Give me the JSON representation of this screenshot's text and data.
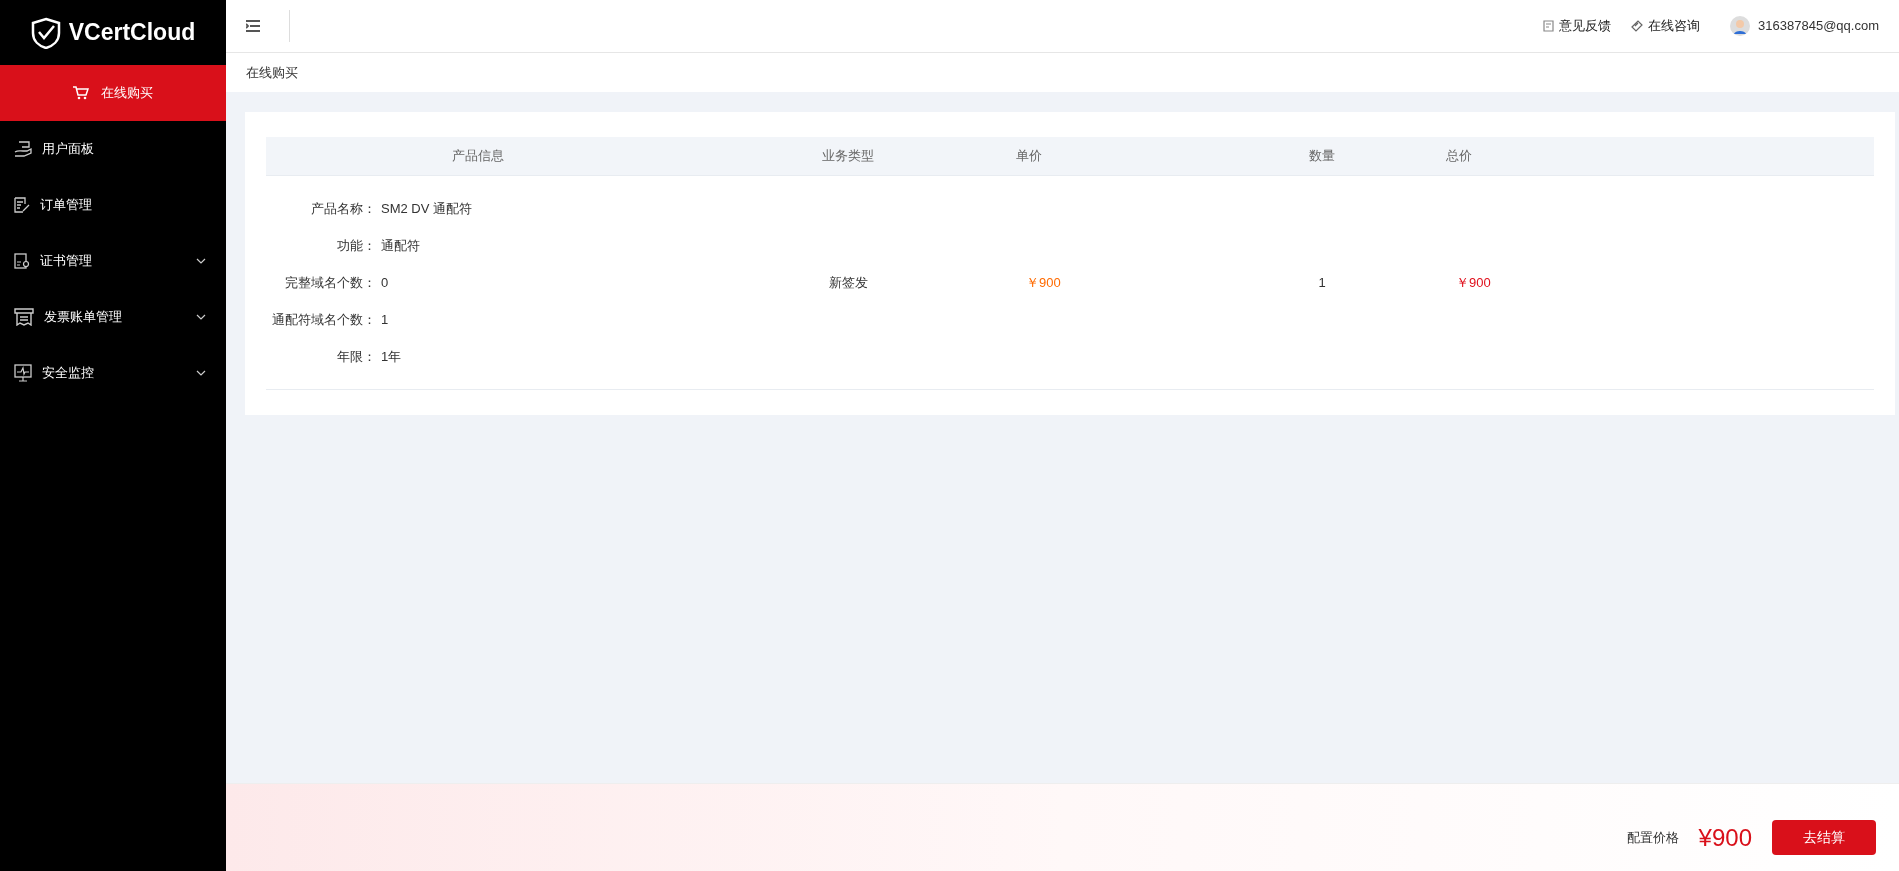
{
  "sidebar": {
    "logo": "VCertCloud",
    "items": [
      {
        "label": "在线购买",
        "selected": true,
        "has_submenu": false
      },
      {
        "label": "用户面板",
        "selected": false,
        "has_submenu": false
      },
      {
        "label": "订单管理",
        "selected": false,
        "has_submenu": false
      },
      {
        "label": "证书管理",
        "selected": false,
        "has_submenu": true
      },
      {
        "label": "发票账单管理",
        "selected": false,
        "has_submenu": true
      },
      {
        "label": "安全监控",
        "selected": false,
        "has_submenu": true
      }
    ]
  },
  "header": {
    "links": [
      "意见反馈",
      "在线咨询"
    ],
    "user": "316387845@qq.com"
  },
  "breadcrumb": "在线购买",
  "table": {
    "columns": [
      "产品信息",
      "业务类型",
      "单价",
      "数量",
      "总价"
    ],
    "row": {
      "details": [
        {
          "label": "产品名称：",
          "value": "SM2 DV 通配符"
        },
        {
          "label": "功能：",
          "value": "通配符"
        },
        {
          "label": "完整域名个数：",
          "value": "0"
        },
        {
          "label": "通配符域名个数：",
          "value": "1"
        },
        {
          "label": "年限：",
          "value": "1年"
        }
      ],
      "business_type": "新签发",
      "unit_price": "￥900",
      "quantity": "1",
      "total": "￥900"
    }
  },
  "footer": {
    "label": "配置价格",
    "price": "¥900",
    "button": "去结算"
  }
}
